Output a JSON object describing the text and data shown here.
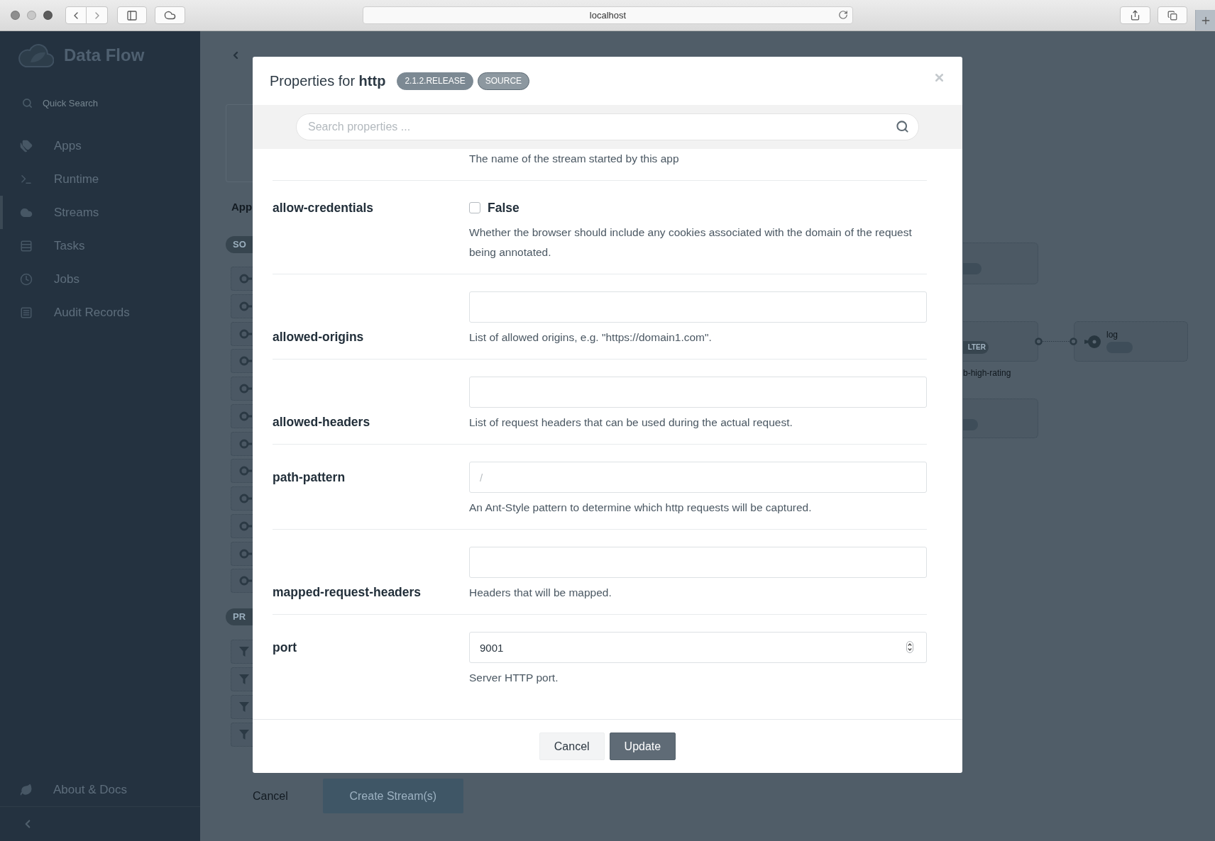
{
  "browser": {
    "address": "localhost"
  },
  "sidebar": {
    "brand": "Data Flow",
    "search": {
      "placeholder": "Quick Search"
    },
    "items": [
      {
        "label": "Apps",
        "selected": false
      },
      {
        "label": "Runtime",
        "selected": false
      },
      {
        "label": "Streams",
        "selected": true
      },
      {
        "label": "Tasks",
        "selected": false
      },
      {
        "label": "Jobs",
        "selected": false
      },
      {
        "label": "Audit Records",
        "selected": false
      }
    ],
    "footer_item": "About & Docs"
  },
  "stream_editor": {
    "section_title": "App",
    "palette": [
      {
        "tag": "SO",
        "items": [
          {
            "kind": "source"
          },
          {
            "kind": "source"
          },
          {
            "kind": "source"
          },
          {
            "kind": "source"
          },
          {
            "kind": "source"
          },
          {
            "kind": "source"
          },
          {
            "kind": "source"
          },
          {
            "kind": "source"
          },
          {
            "kind": "source"
          },
          {
            "kind": "source"
          },
          {
            "kind": "source"
          },
          {
            "kind": "source"
          }
        ]
      },
      {
        "tag": "PR",
        "items": [
          {
            "kind": "processor"
          },
          {
            "kind": "processor"
          },
          {
            "kind": "processor"
          },
          {
            "kind": "processor"
          }
        ]
      }
    ],
    "canvas": {
      "nodes": [
        {
          "kind": "app"
        },
        {
          "kind": "app",
          "tag": "LTER",
          "caption": "b-high-rating",
          "linked": true
        },
        {
          "kind": "app"
        },
        {
          "kind": "sink",
          "label": "log"
        }
      ]
    },
    "buttons": [
      {
        "label": "Cancel",
        "kind": "link"
      },
      {
        "label": "Create Stream(s)",
        "kind": "primary"
      }
    ]
  },
  "modal": {
    "title": "Properties for **http**",
    "badges": [
      {
        "label": "2.1.2.RELEASE",
        "kind": "version"
      },
      {
        "label": "SOURCE",
        "kind": "type"
      }
    ],
    "search": {
      "placeholder": "Search properties ..."
    },
    "properties": [
      {
        "description": "The name of the stream started by this app"
      },
      {
        "name": "allow-credentials",
        "kind": "checkbox",
        "checked": false,
        "value": "False",
        "description": "Whether the browser should include any cookies associated with the domain of the request being annotated."
      },
      {
        "name": "allowed-origins",
        "kind": "list",
        "description": "List of allowed origins, e.g. \"https://domain1.com\"."
      },
      {
        "name": "allowed-headers",
        "kind": "list",
        "description": "List of request headers that can be used during the actual request."
      },
      {
        "name": "path-pattern",
        "kind": "text",
        "placeholder": "/",
        "description": "An Ant-Style pattern to determine which http requests will be captured."
      },
      {
        "name": "mapped-request-headers",
        "kind": "list",
        "description": "Headers that will be mapped."
      },
      {
        "name": "port",
        "kind": "number",
        "value": "9001",
        "description": "Server HTTP port."
      }
    ],
    "buttons": [
      {
        "label": "Cancel",
        "kind": "secondary"
      },
      {
        "label": "Update",
        "kind": "primary"
      }
    ]
  }
}
